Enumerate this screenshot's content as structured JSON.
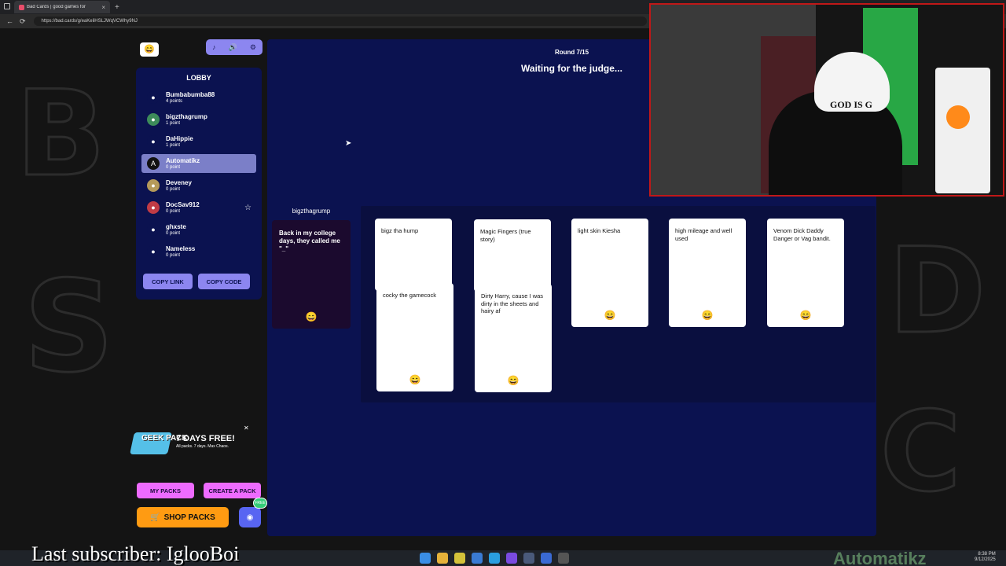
{
  "browser": {
    "tab_title": "Bad Cards | good games for",
    "tab_close": "×",
    "tab_new": "+",
    "url": "https://bad.cards/g/eaKeliHSLJWqVCWhy9NJ",
    "nav_back": "←",
    "nav_reload": "⟳",
    "win_min": "—",
    "win_max": "□",
    "win_close": "✕"
  },
  "game": {
    "round": "Round 7/15",
    "status": "Waiting for the judge..."
  },
  "toolbar": {
    "music_icon": "♪",
    "sound_icon": "🔊",
    "settings_icon": "⚙",
    "logo": "😄"
  },
  "lobby": {
    "title": "LOBBY",
    "players": [
      {
        "name": "Bumbabumba88",
        "points": "4 points",
        "avatar": "●",
        "avatar_color": "#0b1250"
      },
      {
        "name": "bigzthagrump",
        "points": "1 point",
        "avatar": "●",
        "avatar_color": "#3d8b5a"
      },
      {
        "name": "DaHippie",
        "points": "1 point",
        "avatar": "●",
        "avatar_color": "#0b1250"
      },
      {
        "name": "Automatikz",
        "points": "0 point",
        "avatar": "A",
        "avatar_color": "#111111"
      },
      {
        "name": "Deveney",
        "points": "0 point",
        "avatar": "●",
        "avatar_color": "#b59a5a"
      },
      {
        "name": "DocSav912",
        "points": "0 point",
        "avatar": "●",
        "avatar_color": "#c03b45"
      },
      {
        "name": "ghxste",
        "points": "0 point",
        "avatar": "●",
        "avatar_color": "#0b1250"
      },
      {
        "name": "Nameless",
        "points": "0 point",
        "avatar": "●",
        "avatar_color": "#0b1250"
      }
    ],
    "star_icon": "☆",
    "copy_link": "COPY LINK",
    "copy_code": "COPY CODE"
  },
  "promo": {
    "geek": "GEEK PACK",
    "main": "7 DAYS FREE!",
    "sub": "All packs. 7 days. Max Chaos.",
    "close": "✕"
  },
  "buttons": {
    "my_packs": "MY PACKS",
    "create_pack": "CREATE A PACK",
    "shop_packs": "SHOP PACKS",
    "cart_icon": "🛒",
    "discord_icon": "◉",
    "discord_badge": "FREE"
  },
  "black_card": {
    "judge": "bigzthagrump",
    "text": "Back in my college days, they called me \"_\"",
    "logo": "😄"
  },
  "white_cards": [
    {
      "text": "bigz tha hump",
      "logo": "😄"
    },
    {
      "text": "cocky the gamecock",
      "logo": "😄"
    },
    {
      "text": "Magic Fingers (true story)",
      "logo": "😄"
    },
    {
      "text": "Dirty Harry, cause I was dirty in the sheets and hairy af",
      "logo": "😄"
    },
    {
      "text": "light skin Kiesha",
      "logo": "😄"
    },
    {
      "text": "high mileage and well used",
      "logo": "😄"
    },
    {
      "text": "Venom Dick Daddy Danger or Vag bandit.",
      "logo": "😄"
    }
  ],
  "webcam": {
    "cap_text": "GOD IS G"
  },
  "overlay": {
    "subscriber": "Last subscriber: IglooBoi",
    "brand": "Automatikz",
    "time": "8:38 PM",
    "date": "9/12/2025"
  },
  "cursor": "➤"
}
